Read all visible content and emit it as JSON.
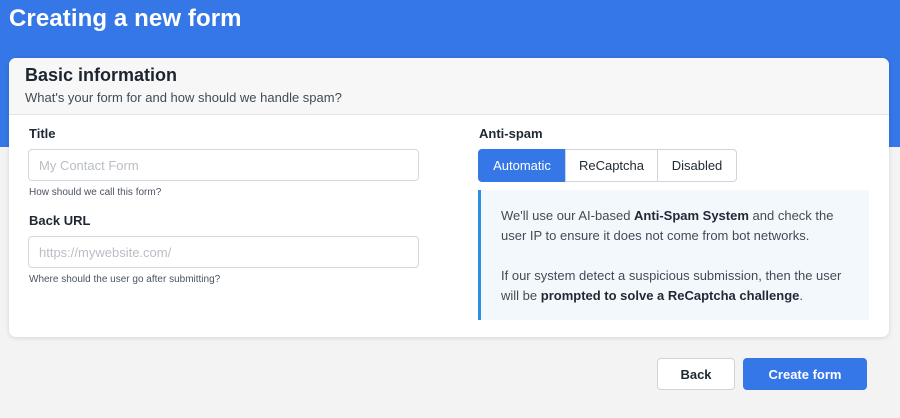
{
  "page": {
    "title": "Creating a new form"
  },
  "card": {
    "title": "Basic information",
    "subtitle": "What's your form for and how should we handle spam?"
  },
  "fields": {
    "title": {
      "label": "Title",
      "value": "",
      "placeholder": "My Contact Form",
      "hint": "How should we call this form?"
    },
    "back_url": {
      "label": "Back URL",
      "value": "",
      "placeholder": "https://mywebsite.com/",
      "hint": "Where should the user go after submitting?"
    }
  },
  "antispam": {
    "label": "Anti-spam",
    "options": [
      "Automatic",
      "ReCaptcha",
      "Disabled"
    ],
    "selected": "Automatic",
    "info": {
      "p1_pre": "We'll use our AI-based ",
      "p1_bold": "Anti-Spam System",
      "p1_post": " and check the user IP to ensure it does not come from bot networks.",
      "p2_pre": "If our system detect a suspicious submission, then the user will be ",
      "p2_bold": "prompted to solve a ReCaptcha challenge",
      "p2_post": "."
    }
  },
  "actions": {
    "back_label": "Back",
    "create_label": "Create form"
  },
  "colors": {
    "primary": "#3577e6",
    "info_border": "#2c8fe0",
    "info_bg": "#f3f8fd"
  }
}
